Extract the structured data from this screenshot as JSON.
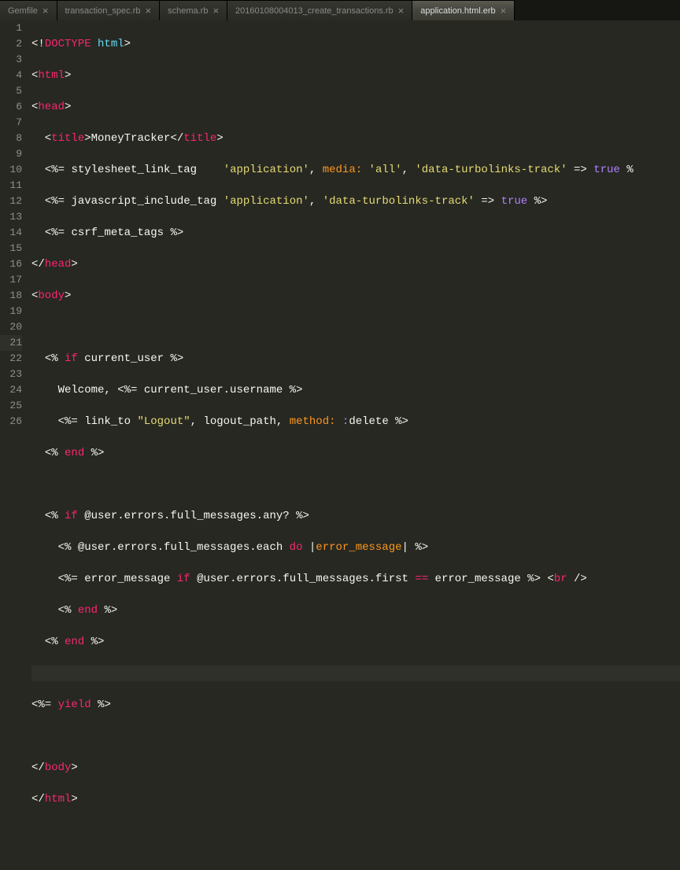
{
  "tabs": [
    {
      "label": "Gemfile",
      "active": false
    },
    {
      "label": "transaction_spec.rb",
      "active": false
    },
    {
      "label": "schema.rb",
      "active": false
    },
    {
      "label": "20160108004013_create_transactions.rb",
      "active": false
    },
    {
      "label": "application.html.erb",
      "active": true
    }
  ],
  "closeGlyph": "×",
  "lineCount": 26,
  "cursorLine": 21,
  "tokens": {
    "l1": {
      "a": "<!",
      "b": "DOCTYPE",
      "c": " ",
      "d": "html",
      "e": ">"
    },
    "l2": {
      "a": "<",
      "b": "html",
      "c": ">"
    },
    "l3": {
      "a": "<",
      "b": "head",
      "c": ">"
    },
    "l4": {
      "a": "  <",
      "b": "title",
      "c": ">",
      "d": "MoneyTracker",
      "e": "</",
      "f": "title",
      "g": ">"
    },
    "l5": {
      "a": "  ",
      "b": "<%=",
      "c": " ",
      "d": "stylesheet_link_tag",
      "e": "    ",
      "f": "'application'",
      "g": ", ",
      "h": "media:",
      "i": " ",
      "j": "'all'",
      "k": ", ",
      "l": "'data-turbolinks-track'",
      "m": " => ",
      "n": "true",
      "o": " ",
      "p": "%"
    },
    "l6": {
      "a": "  ",
      "b": "<%=",
      "c": " ",
      "d": "javascript_include_tag",
      "e": " ",
      "f": "'application'",
      "g": ", ",
      "h": "'data-turbolinks-track'",
      "i": " => ",
      "j": "true",
      "k": " ",
      "l": "%>"
    },
    "l7": {
      "a": "  ",
      "b": "<%=",
      "c": " ",
      "d": "csrf_meta_tags",
      "e": " ",
      "f": "%>"
    },
    "l8": {
      "a": "</",
      "b": "head",
      "c": ">"
    },
    "l9": {
      "a": "<",
      "b": "body",
      "c": ">"
    },
    "l11": {
      "a": "  ",
      "b": "<%",
      "c": " ",
      "d": "if",
      "e": " current_user ",
      "f": "%>"
    },
    "l12": {
      "a": "    Welcome, ",
      "b": "<%=",
      "c": " current_user.username ",
      "d": "%>"
    },
    "l13": {
      "a": "    ",
      "b": "<%=",
      "c": " link_to ",
      "d": "\"Logout\"",
      "e": ", logout_path, ",
      "f": "method:",
      "g": " ",
      "h": ":",
      "i": "delete ",
      "j": "%>"
    },
    "l14": {
      "a": "  ",
      "b": "<%",
      "c": " ",
      "d": "end",
      "e": " ",
      "f": "%>"
    },
    "l16": {
      "a": "  ",
      "b": "<%",
      "c": " ",
      "d": "if",
      "e": " @user.errors.full_messages.any? ",
      "f": "%>"
    },
    "l17": {
      "a": "    ",
      "b": "<%",
      "c": " @user.errors.full_messages.each ",
      "d": "do",
      "e": " |",
      "f": "error_message",
      "g": "| ",
      "h": "%>"
    },
    "l18": {
      "a": "    ",
      "b": "<%=",
      "c": " error_message ",
      "d": "if",
      "e": " @user.errors.full_messages.first ",
      "f": "==",
      "g": " error_message ",
      "h": "%>",
      "i": " <",
      "j": "br",
      "k": " />"
    },
    "l19": {
      "a": "    ",
      "b": "<%",
      "c": " ",
      "d": "end",
      "e": " ",
      "f": "%>"
    },
    "l20": {
      "a": "  ",
      "b": "<%",
      "c": " ",
      "d": "end",
      "e": " ",
      "f": "%>"
    },
    "l22": {
      "a": "<%=",
      "b": " ",
      "c": "yield",
      "d": " ",
      "e": "%>"
    },
    "l24": {
      "a": "</",
      "b": "body",
      "c": ">"
    },
    "l25": {
      "a": "</",
      "b": "html",
      "c": ">"
    }
  }
}
